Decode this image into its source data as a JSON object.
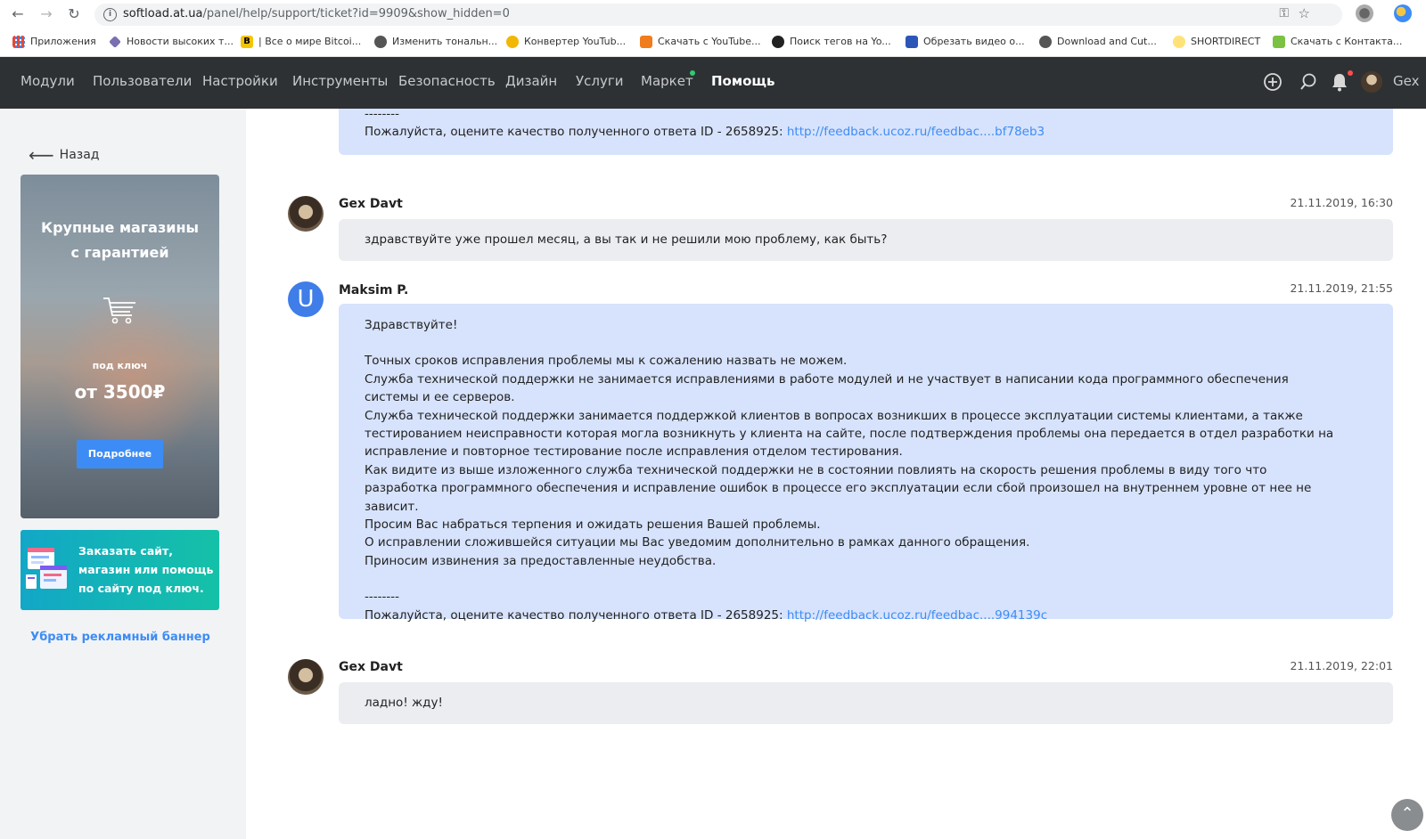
{
  "browser": {
    "url_host": "softload.at.ua",
    "url_path": "/panel/help/support/ticket?id=9909&show_hidden=0",
    "bookmarks": [
      "Приложения",
      "Новости высоких т...",
      "| Все о мире Bitcoi...",
      "Изменить тональн...",
      "Конвертер YouTub...",
      "Скачать с YouTube...",
      "Поиск тегов на Yo...",
      "Обрезать видео о...",
      "Download and Cut...",
      "SHORTDIRECT",
      "Скачать с Контакта..."
    ]
  },
  "nav": {
    "items": [
      "Модули",
      "Пользователи",
      "Настройки",
      "Инструменты",
      "Безопасность",
      "Дизайн",
      "Услуги",
      "Маркет",
      "Помощь"
    ],
    "user": "Gex"
  },
  "sidebar": {
    "back": "Назад",
    "promo": {
      "title_line1": "Крупные магазины",
      "title_line2": "с гарантией",
      "subtitle": "под ключ",
      "price": "от 3500₽",
      "button": "Подробнее"
    },
    "banner2": "Заказать сайт, магазин или помощь по сайту под ключ.",
    "remove_banner": "Убрать рекламный баннер"
  },
  "messages": [
    {
      "type": "support-partial",
      "separator": "--------",
      "rating_prefix": "Пожалуйста, оцените качество полученного ответа ID - 2658925: ",
      "rating_link": "http://feedback.ucoz.ru/feedbac....bf78eb3"
    },
    {
      "author": "Gex Davt",
      "time": "21.11.2019, 16:30",
      "text": "здравствуйте уже прошел месяц, а вы так и не решили мою проблему, как быть?"
    },
    {
      "author": "Maksim P.",
      "avatar_letter": "U",
      "time": "21.11.2019, 21:55",
      "greeting": "Здравствуйте!",
      "body": "Точных сроков исправления проблемы мы к сожалению назвать не можем.\nСлужба технической поддержки не занимается исправлениями в работе модулей и не участвует в написании кода программного обеспечения системы и ее серверов.\nСлужба технической поддержки занимается поддержкой клиентов в вопросах возникших в процессе эксплуатации системы клиентами, а также тестированием неисправности которая могла возникнуть у клиента на сайте, после подтверждения проблемы она передается в отдел разработки на исправление и повторное тестирование после исправления отделом тестирования.\nКак видите из выше изложенного служба технической поддержки не в состоянии повлиять на скорость решения проблемы в виду того что разработка программного обеспечения и исправление ошибок в процессе его эксплуатации если сбой произошел на внутреннем уровне от нее не зависит.\nПросим Вас набраться терпения и ожидать решения Вашей проблемы.\nО исправлении сложившейся ситуации мы Вас уведомим дополнительно в рамках данного обращения.\nПриносим извинения за предоставленные неудобства.",
      "separator": "--------",
      "rating_prefix": "Пожалуйста, оцените качество полученного ответа ID - 2658925: ",
      "rating_link": "http://feedback.ucoz.ru/feedbac....994139c"
    },
    {
      "author": "Gex Davt",
      "time": "21.11.2019, 22:01",
      "text": "ладно! жду!"
    }
  ],
  "colors": {
    "nav_bg": "#2e3133",
    "support_bubble": "#d7e3fc",
    "user_bubble": "#ebedf1",
    "accent": "#3d8cf5"
  }
}
